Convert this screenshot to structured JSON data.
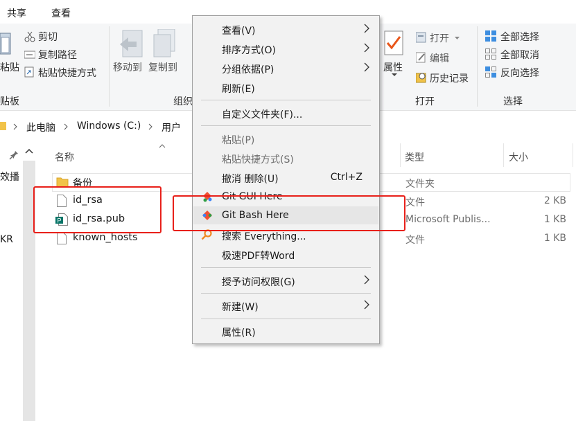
{
  "tabs": [
    "共享",
    "查看"
  ],
  "ribbon": {
    "paste_partial": "粘贴",
    "cut": "剪切",
    "copy_path": "复制路径",
    "paste_shortcut": "粘贴快捷方式",
    "clipboard_group_partial": "贴板",
    "move_to": "移动到",
    "copy_to": "复制到",
    "organize_group_partial": "组织",
    "properties": "属性",
    "open": "打开",
    "edit": "编辑",
    "history": "历史记录",
    "open_group": "打开",
    "select_all": "全部选择",
    "select_none": "全部取消",
    "invert_select": "反向选择",
    "select_group": "选择"
  },
  "address": {
    "crumbs": [
      "此电脑",
      "Windows (C:)",
      "用户"
    ]
  },
  "nav_partial": [
    "效播",
    "KR"
  ],
  "columns": {
    "name": "名称",
    "type": "类型",
    "size": "大小"
  },
  "files": [
    {
      "name": "备份",
      "type": "文件夹",
      "size": ""
    },
    {
      "name": "id_rsa",
      "type": "文件",
      "size": "2 KB"
    },
    {
      "name": "id_rsa.pub",
      "type": "Microsoft Publis...",
      "size": "1 KB"
    },
    {
      "name": "known_hosts",
      "type": "文件",
      "size": "1 KB"
    }
  ],
  "menu": {
    "view": "查看(V)",
    "sort": "排序方式(O)",
    "group": "分组依据(P)",
    "refresh": "刷新(E)",
    "customize": "自定义文件夹(F)...",
    "paste": "粘贴(P)",
    "paste_shortcut": "粘贴快捷方式(S)",
    "undo": "撤消 删除(U)",
    "undo_shortcut": "Ctrl+Z",
    "git_gui": "Git GUI Here",
    "git_bash": "Git Bash Here",
    "search_everything": "搜索 Everything...",
    "pdf_word": "极速PDF转Word",
    "grant_access": "授予访问权限(G)",
    "new": "新建(W)",
    "properties": "属性(R)"
  },
  "colors": {
    "highlight_red": "#e8201a",
    "folder_yellow": "#f1c34a",
    "menu_bg": "#f2f2f2"
  }
}
